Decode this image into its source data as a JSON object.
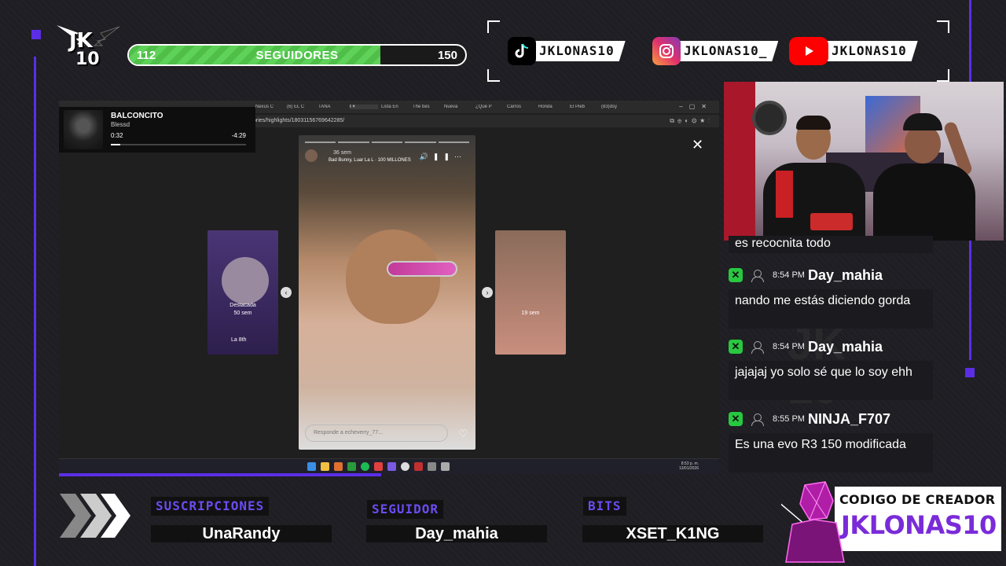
{
  "goal": {
    "current": "112",
    "label": "SEGUIDORES",
    "target": "150",
    "fraction": 0.747
  },
  "logo": {
    "line1": "JK",
    "line2": "10"
  },
  "socials": [
    {
      "platform": "tiktok",
      "icon": "tiktok-icon",
      "name": "JKLONAS10"
    },
    {
      "platform": "instagram",
      "icon": "instagram-icon",
      "name": "JKLONAS10_"
    },
    {
      "platform": "youtube",
      "icon": "youtube-icon",
      "name": "JKLONAS10"
    }
  ],
  "browser": {
    "url": "…ories/highlights/18031156769642285/",
    "tabs": [
      "Nexus C",
      "(6) EL C",
      "TANA",
      "I ×",
      "Lista En",
      "The bes",
      "Nueva",
      "¿Qué P",
      "Carros",
      "Honda",
      "El Pieb",
      "(83)dsy"
    ],
    "active_tab": 3,
    "music": {
      "title": "BALCONCITO",
      "artist": "Blessd",
      "current": "0:32",
      "total": "-4:29",
      "progress": 0.068
    },
    "story": {
      "time": "36 sem",
      "song": "Bad Bunny, Luar La L · 100 MILLONES",
      "reply_placeholder": "Responde a echeverry_77...",
      "left_label": "Destacada",
      "left_time": "50 sem",
      "left_user": "La 8th",
      "right_time": "19 sem"
    },
    "taskbar_time": "8:53 p. m.",
    "taskbar_date": "13/01/2026"
  },
  "chat": {
    "partial": "es recocnita todo",
    "messages": [
      {
        "time": "8:54 PM",
        "user": "Day_mahia",
        "text": "nando me estás diciendo gorda"
      },
      {
        "time": "8:54 PM",
        "user": "Day_mahia",
        "text": "jajajaj yo solo sé que lo soy ehh"
      },
      {
        "time": "8:55 PM",
        "user": "NINJA_F707",
        "text": "Es una evo R3 150 modificada"
      }
    ]
  },
  "stats": [
    {
      "label": "SUSCRIPCIONES",
      "value": "UnaRandy"
    },
    {
      "label": "SEGUIDOR",
      "value": "Day_mahia"
    },
    {
      "label": "BITS",
      "value": "XSET_K1NG"
    }
  ],
  "creator": {
    "title": "CODIGO DE CREADOR",
    "code": "JKLONAS10"
  },
  "colors": {
    "accent": "#5b2ee6",
    "goal": "#5fd25a",
    "creator_code": "#7a2bd9"
  }
}
